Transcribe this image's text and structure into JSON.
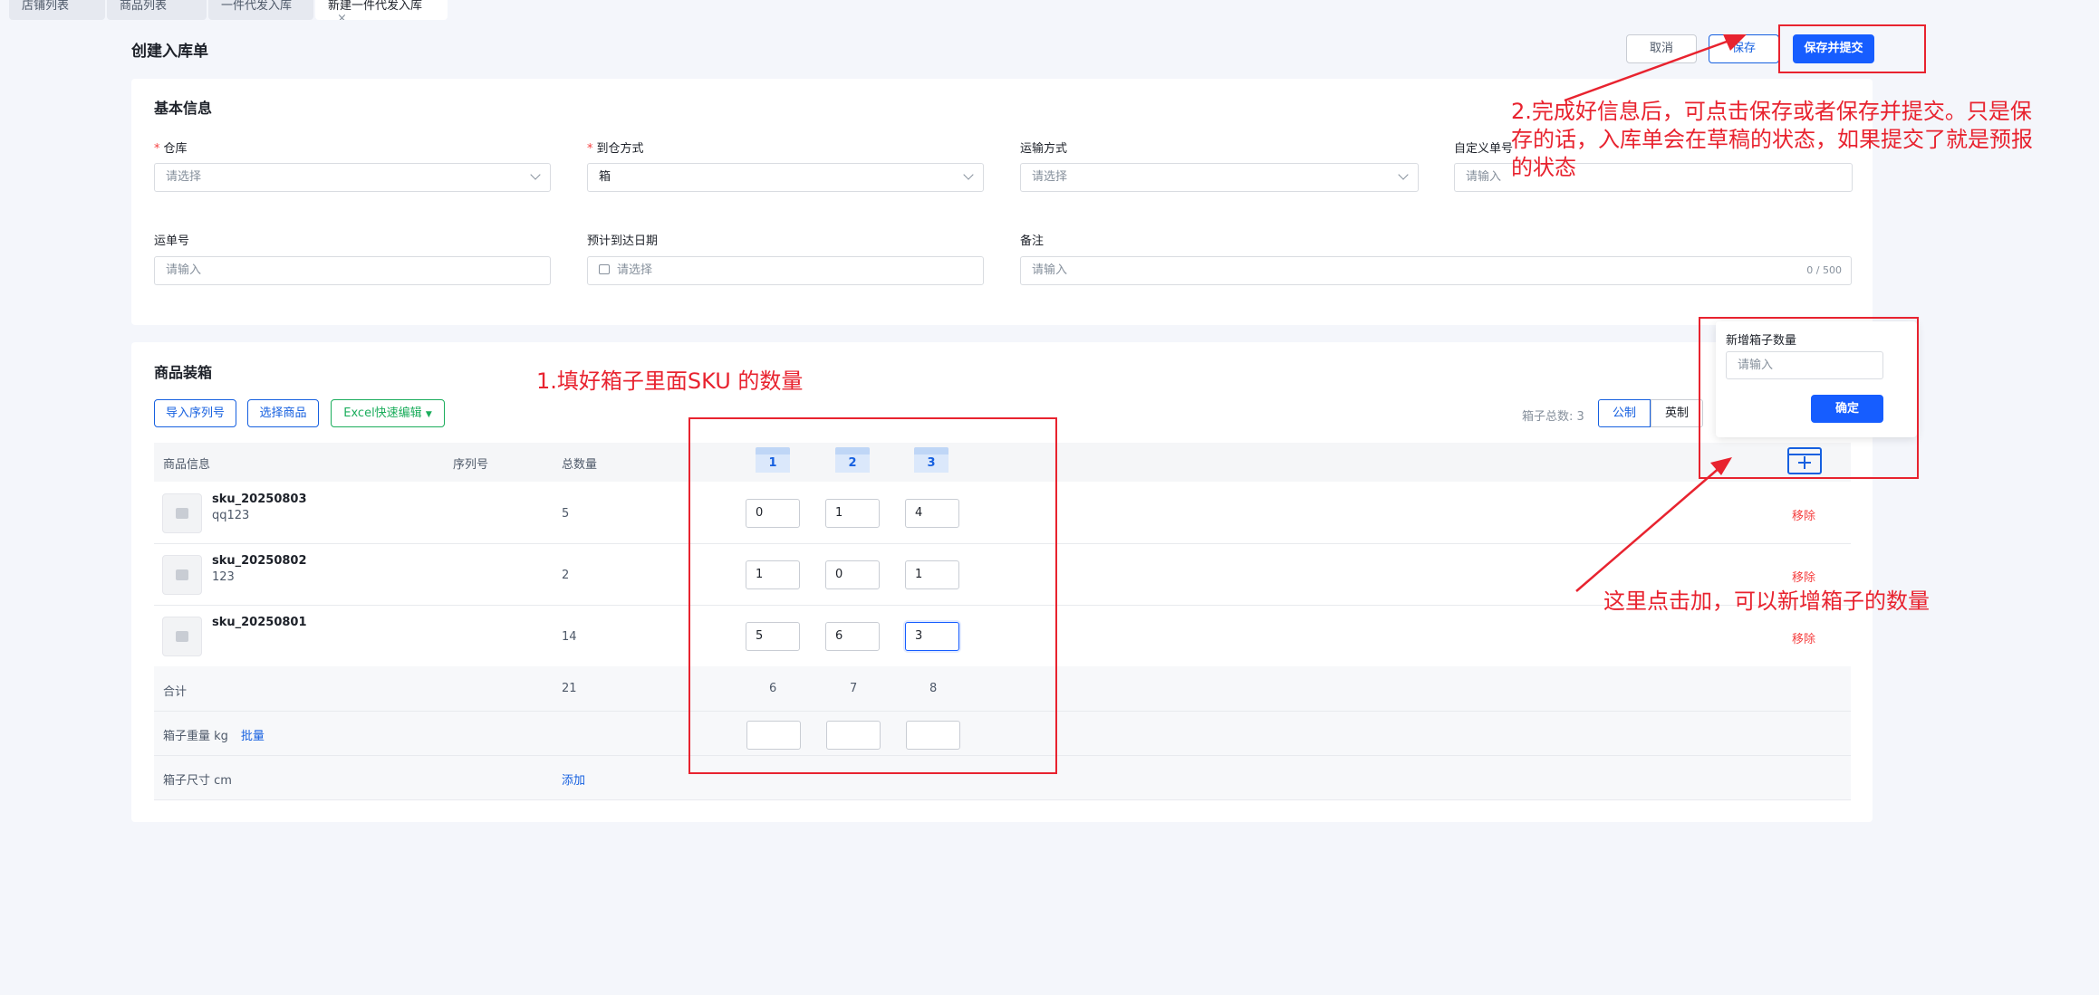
{
  "tabs": [
    {
      "label": "店铺列表",
      "active": false
    },
    {
      "label": "商品列表",
      "active": false
    },
    {
      "label": "一件代发入库",
      "active": false
    },
    {
      "label": "新建一件代发入库",
      "active": true,
      "close": "×"
    }
  ],
  "page": {
    "title": "创建入库单",
    "buttons": {
      "cancel": "取消",
      "save": "保存",
      "save_submit": "保存并提交"
    }
  },
  "basic": {
    "title": "基本信息",
    "warehouse": {
      "label": "仓库",
      "placeholder": "请选择",
      "required": true
    },
    "arrival": {
      "label": "到仓方式",
      "value": "箱",
      "required": true
    },
    "shipping": {
      "label": "运输方式",
      "placeholder": "请选择"
    },
    "custom_no": {
      "label": "自定义单号",
      "placeholder": "请输入"
    },
    "waybill": {
      "label": "运单号",
      "placeholder": "请输入"
    },
    "eta": {
      "label": "预计到达日期",
      "placeholder": "请选择"
    },
    "remark": {
      "label": "备注",
      "placeholder": "请输入",
      "counter": "0 / 500"
    }
  },
  "packing": {
    "title": "商品装箱",
    "btn_import": "导入序列号",
    "btn_select": "选择商品",
    "btn_excel": "Excel快速编辑",
    "box_total_label": "箱子总数:",
    "box_total": "3",
    "unit_metric": "公制",
    "unit_imperial": "英制",
    "columns": {
      "info": "商品信息",
      "serial": "序列号",
      "total": "总数量"
    },
    "boxes": [
      "1",
      "2",
      "3"
    ],
    "rows": [
      {
        "sku": "sku_20250803",
        "sub": "qq123",
        "total": "5",
        "qty": [
          "0",
          "1",
          "4"
        ],
        "remove": "移除"
      },
      {
        "sku": "sku_20250802",
        "sub": "123",
        "total": "2",
        "qty": [
          "1",
          "0",
          "1"
        ],
        "remove": "移除"
      },
      {
        "sku": "sku_20250801",
        "sub": "",
        "total": "14",
        "qty": [
          "5",
          "6",
          "3"
        ],
        "remove": "移除"
      }
    ],
    "sum_label": "合计",
    "sum_total": "21",
    "sum_boxes": [
      "6",
      "7",
      "8"
    ],
    "weight_label": "箱子重量 kg",
    "weight_batch": "批量",
    "size_label": "箱子尺寸 cm",
    "size_add": "添加"
  },
  "popover": {
    "title": "新增箱子数量",
    "placeholder": "请输入",
    "confirm": "确定"
  },
  "annotations": {
    "step1": "1.填好箱子里面SKU 的数量",
    "step2_lines": [
      "2.完成好信息后，可点击保存或者保存并提交。只是保",
      "存的话，入库单会在草稿的状态，如果提交了就是预报",
      "的状态"
    ],
    "add_box": "这里点击加，可以新增箱子的数量"
  },
  "colors": {
    "primary": "#165dff",
    "danger": "#f53f3f",
    "annotation": "#e8232f",
    "success": "#1bad5c"
  }
}
